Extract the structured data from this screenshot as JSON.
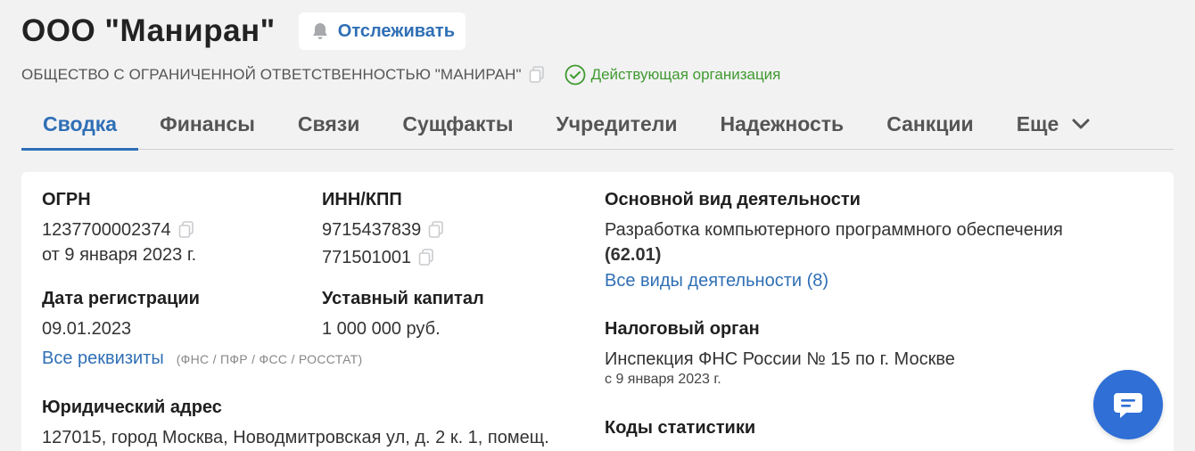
{
  "header": {
    "company_title": "ООО \"Маниран\"",
    "follow_label": "Отслеживать",
    "full_name": "ОБЩЕСТВО С ОГРАНИЧЕННОЙ ОТВЕТСТВЕННОСТЬЮ \"МАНИРАН\"",
    "status_label": "Действующая организация"
  },
  "tabs": [
    {
      "label": "Сводка",
      "active": true
    },
    {
      "label": "Финансы"
    },
    {
      "label": "Связи"
    },
    {
      "label": "Сущфакты"
    },
    {
      "label": "Учредители"
    },
    {
      "label": "Надежность"
    },
    {
      "label": "Санкции"
    },
    {
      "label": "Еще"
    }
  ],
  "card": {
    "ogrn": {
      "label": "ОГРН",
      "value": "1237700002374",
      "date": "от 9 января 2023 г."
    },
    "inn_kpp": {
      "label": "ИНН/КПП",
      "inn": "9715437839",
      "kpp": "771501001"
    },
    "reg_date": {
      "label": "Дата регистрации",
      "value": "09.01.2023"
    },
    "capital": {
      "label": "Уставный капитал",
      "value": "1 000 000 руб."
    },
    "requisites": {
      "link": "Все реквизиты",
      "sources": "(ФНС / ПФР / ФСС / РОССТАТ)"
    },
    "address": {
      "label": "Юридический адрес",
      "value": "127015, город Москва, Новодмитровская ул, д. 2 к. 1, помещ."
    },
    "activity": {
      "label": "Основной вид деятельности",
      "value": "Разработка компьютерного программного обеспечения",
      "code": "(62.01)",
      "link": "Все виды деятельности (8)"
    },
    "tax": {
      "label": "Налоговый орган",
      "value": "Инспекция ФНС России № 15 по г. Москве",
      "since": "с 9 января 2023 г."
    },
    "stats": {
      "label": "Коды статистики"
    }
  },
  "colors": {
    "accent": "#2f6fb5",
    "status": "#3f9a2f",
    "chat": "#2f6fd6"
  },
  "icons": [
    "bell-icon",
    "copy-icon",
    "check-circle-icon",
    "chevron-down-icon",
    "chat-icon"
  ]
}
